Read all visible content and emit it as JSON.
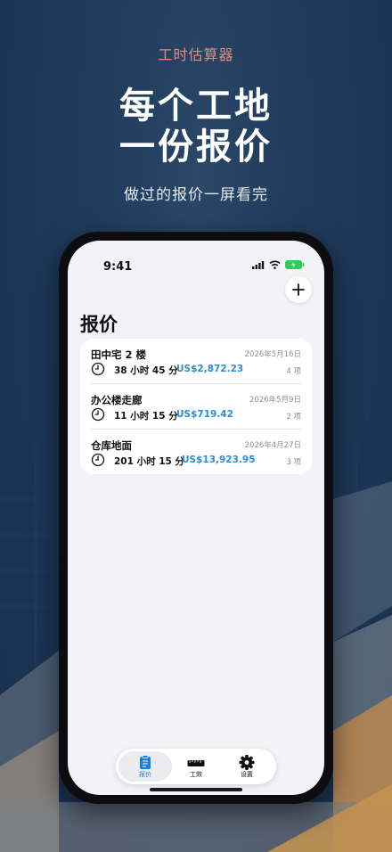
{
  "promo": {
    "app_name": "工时估算器",
    "headline_line1": "每个工地",
    "headline_line2": "一份报价",
    "subheadline": "做过的报价一屏看完"
  },
  "status_bar": {
    "time": "9:41"
  },
  "page": {
    "title": "报价"
  },
  "quotes": [
    {
      "name": "田中宅 2 楼",
      "date": "2026年5月16日",
      "hours": "38 小时 45 分",
      "price": "US$2,872.23",
      "count": "4 项"
    },
    {
      "name": "办公楼走廊",
      "date": "2026年5月9日",
      "hours": "11 小时 15 分",
      "price": "US$719.42",
      "count": "2 项"
    },
    {
      "name": "仓库地面",
      "date": "2026年4月27日",
      "hours": "201 小时 15 分",
      "price": "US$13,923.95",
      "count": "3 项"
    }
  ],
  "tabs": [
    {
      "label": "报价",
      "icon": "clipboard-icon",
      "active": true
    },
    {
      "label": "工效",
      "icon": "ruler-icon",
      "active": false
    },
    {
      "label": "设置",
      "icon": "gear-icon",
      "active": false
    }
  ],
  "colors": {
    "accent": "#2a8bd6",
    "app_name": "#e68a80",
    "background": "#1d3452"
  }
}
